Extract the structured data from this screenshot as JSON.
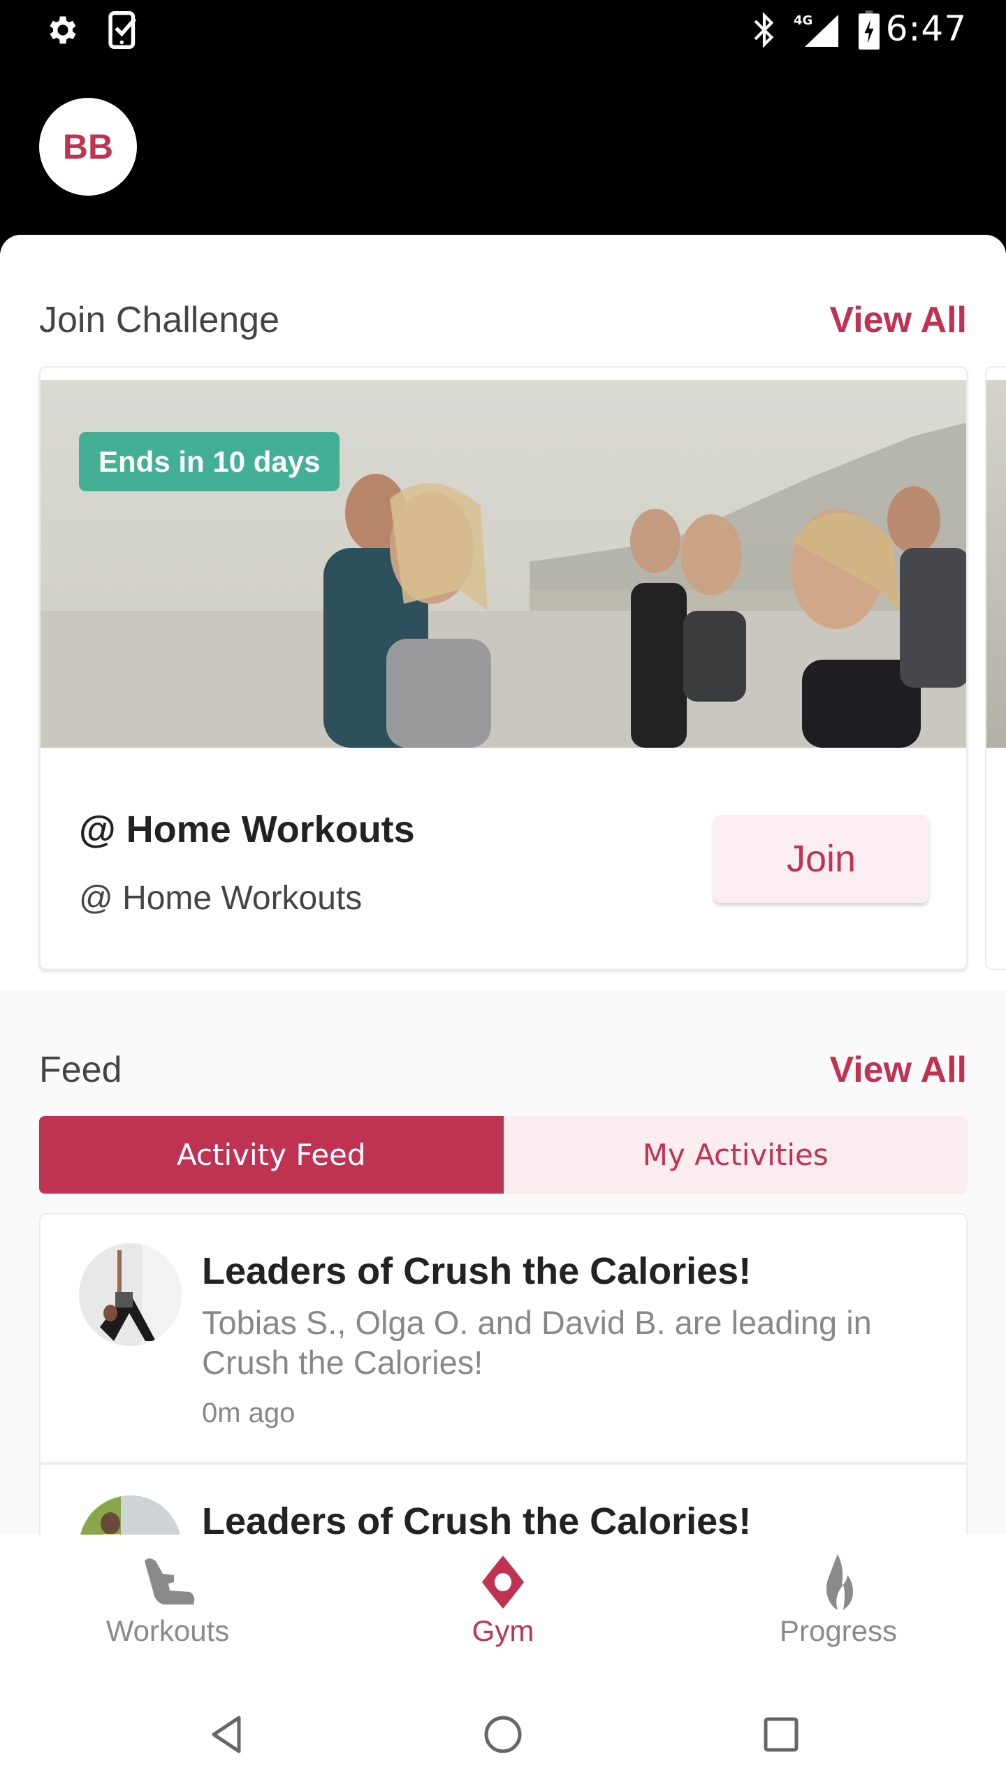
{
  "status_bar": {
    "left_icons": [
      "settings-icon",
      "device-check-icon"
    ],
    "right_icons": [
      "bluetooth-icon",
      "4g-signal-icon",
      "battery-charging-icon"
    ],
    "network_label": "4G",
    "time": "6:47"
  },
  "header": {
    "avatar_initials": "BB"
  },
  "challenges": {
    "title": "Join Challenge",
    "view_all": "View All",
    "cards": [
      {
        "badge": "Ends in 10 days",
        "title": "@ Home Workouts",
        "subtitle": "@ Home Workouts",
        "join_label": "Join"
      }
    ]
  },
  "feed": {
    "title": "Feed",
    "view_all": "View All",
    "tabs": [
      {
        "label": "Activity Feed",
        "active": true
      },
      {
        "label": "My Activities",
        "active": false
      }
    ],
    "items": [
      {
        "title": "Leaders of Crush the Calories!",
        "body": "Tobias S., Olga O. and David B. are leading in Crush the Calories!",
        "time": "0m ago"
      },
      {
        "title": "Leaders of Crush the Calories!",
        "body": "",
        "time": ""
      }
    ]
  },
  "bottom_nav": {
    "items": [
      {
        "label": "Workouts",
        "icon": "shoe-icon",
        "active": false
      },
      {
        "label": "Gym",
        "icon": "gym-location-icon",
        "active": true
      },
      {
        "label": "Progress",
        "icon": "flame-icon",
        "active": false
      }
    ]
  },
  "system_nav": {
    "buttons": [
      "back-icon",
      "home-icon",
      "recents-icon"
    ]
  },
  "colors": {
    "accent": "#c03252",
    "accent_light": "#fbecf0",
    "badge_green": "#43af95",
    "inactive_gray": "#8a8a8a"
  }
}
